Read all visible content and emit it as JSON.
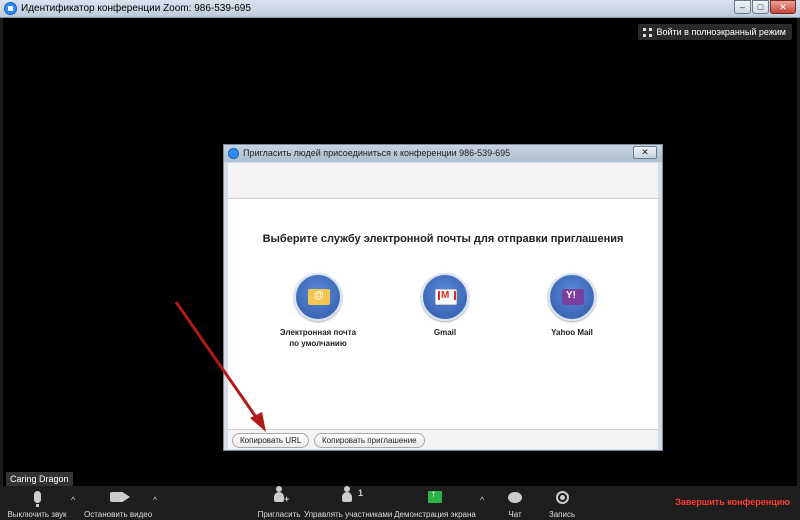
{
  "window": {
    "title": "Идентификатор конференции Zoom: 986-539-695",
    "min_glyph": "–",
    "max_glyph": "□",
    "close_glyph": "✕",
    "fullscreen_label": "Войти в полноэкранный режим"
  },
  "dialog": {
    "title": "Пригласить людей присоединиться к конференции 986-539-695",
    "close_glyph": "✕",
    "heading": "Выберите службу электронной почты для отправки приглашения",
    "options": [
      {
        "label_line1": "Электронная почта",
        "label_line2": "по умолчанию",
        "icon": "default-email-icon"
      },
      {
        "label_line1": "Gmail",
        "label_line2": "",
        "icon": "gmail-icon"
      },
      {
        "label_line1": "Yahoo Mail",
        "label_line2": "",
        "icon": "yahoo-mail-icon"
      }
    ],
    "copy_url": "Копировать URL",
    "copy_invite": "Копировать приглашение"
  },
  "participant_name": "Caring Dragon",
  "toolbar": {
    "mute": "Выключить звук",
    "stop_video": "Остановить видео",
    "invite": "Пригласить",
    "participants": "Управлять участниками",
    "participants_count": "1",
    "share": "Демонстрация экрана",
    "chat": "Чат",
    "record": "Запись",
    "end": "Завершить конференцию",
    "caret": "^"
  },
  "colors": {
    "background": "#000000",
    "end_button": "#ff3b30",
    "share_green": "#2db24a",
    "arrow_red": "#b01a1a"
  }
}
